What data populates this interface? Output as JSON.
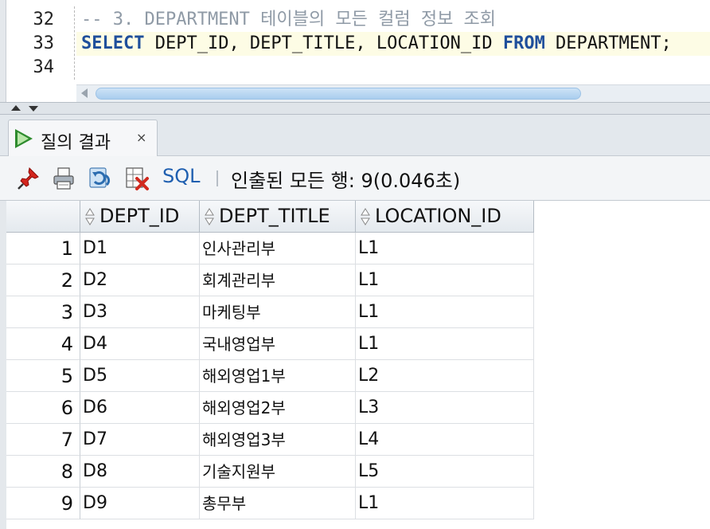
{
  "editor": {
    "line_numbers": [
      "32",
      "33",
      "34"
    ],
    "comment_line": "-- 3. DEPARTMENT 테이블의 모든 컬럼 정보 조회",
    "sql": {
      "kw_select": "SELECT",
      "columns": " DEPT_ID, DEPT_TITLE, LOCATION_ID ",
      "kw_from": "FROM",
      "table": " DEPARTMENT;"
    }
  },
  "results": {
    "tab_label": "질의 결과",
    "tab_close": "×",
    "toolbar": {
      "icons": [
        "pin-icon",
        "print-icon",
        "refresh-icon",
        "export-icon"
      ],
      "sql_label": "SQL",
      "status": "인출된 모든 행: 9(0.046초)"
    },
    "columns": [
      "DEPT_ID",
      "DEPT_TITLE",
      "LOCATION_ID"
    ],
    "rows": [
      {
        "num": "1",
        "dept_id": "D1",
        "dept_title": "인사관리부",
        "location_id": "L1"
      },
      {
        "num": "2",
        "dept_id": "D2",
        "dept_title": "회계관리부",
        "location_id": "L1"
      },
      {
        "num": "3",
        "dept_id": "D3",
        "dept_title": "마케팅부",
        "location_id": "L1"
      },
      {
        "num": "4",
        "dept_id": "D4",
        "dept_title": "국내영업부",
        "location_id": "L1"
      },
      {
        "num": "5",
        "dept_id": "D5",
        "dept_title": "해외영업1부",
        "location_id": "L2"
      },
      {
        "num": "6",
        "dept_id": "D6",
        "dept_title": "해외영업2부",
        "location_id": "L3"
      },
      {
        "num": "7",
        "dept_id": "D7",
        "dept_title": "해외영업3부",
        "location_id": "L4"
      },
      {
        "num": "8",
        "dept_id": "D8",
        "dept_title": "기술지원부",
        "location_id": "L5"
      },
      {
        "num": "9",
        "dept_id": "D9",
        "dept_title": "총무부",
        "location_id": "L1"
      }
    ]
  },
  "colors": {
    "keyword": "#1f4f9b",
    "comment": "#8f9aa6",
    "current_line": "#fdfce5",
    "sql_link": "#1f5fb0"
  }
}
